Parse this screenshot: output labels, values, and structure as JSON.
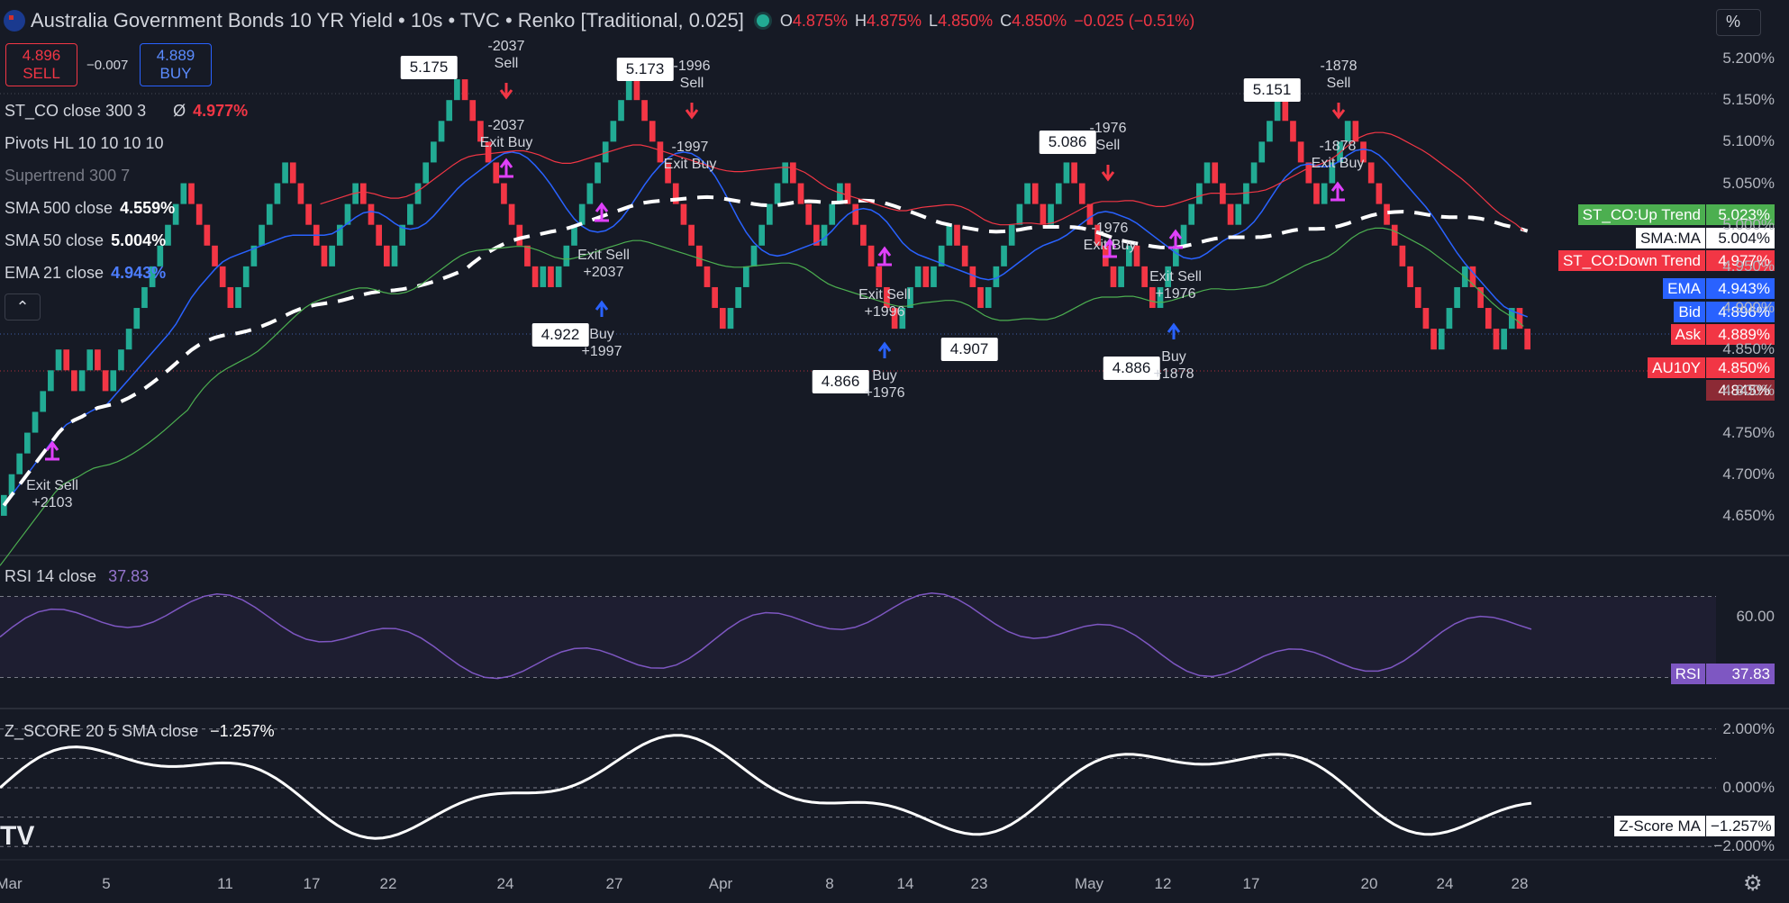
{
  "header": {
    "title": "Australia Government Bonds 10 YR Yield • 10s • TVC • Renko [Traditional, 0.025]",
    "ohlc": [
      {
        "k": "O",
        "v": "4.875%"
      },
      {
        "k": "H",
        "v": "4.875%"
      },
      {
        "k": "L",
        "v": "4.850%"
      },
      {
        "k": "C",
        "v": "4.850%"
      }
    ],
    "change": "−0.025 (−0.51%)",
    "scale_button": "%"
  },
  "trade": {
    "sell_price": "4.896",
    "sell_label": "SELL",
    "spread": "−0.007",
    "buy_price": "4.889",
    "buy_label": "BUY"
  },
  "indicators": [
    {
      "name": "ST_CO close 300 3",
      "extra": "Ø",
      "value": "4.977%",
      "color": "#f23645"
    },
    {
      "name": "Pivots HL 10 10 10 10",
      "value": "",
      "color": "#d1d4dc"
    },
    {
      "name": "Supertrend 300 7",
      "value": "",
      "color": "#787b86"
    },
    {
      "name": "SMA 500 close",
      "value": "4.559%",
      "color": "#ffffff"
    },
    {
      "name": "SMA 50 close",
      "value": "5.004%",
      "color": "#ffffff"
    },
    {
      "name": "EMA 21 close",
      "value": "4.943%",
      "color": "#4c7dff"
    }
  ],
  "price_tags": [
    {
      "label": "ST_CO:Up Trend",
      "value": "5.023%",
      "bg": "#4caf50",
      "fg": "#ffffff"
    },
    {
      "label": "SMA:MA",
      "value": "5.004%",
      "bg": "#ffffff",
      "fg": "#131722"
    },
    {
      "label": "ST_CO:Down Trend",
      "value": "4.977%",
      "bg": "#f23645",
      "fg": "#ffffff"
    },
    {
      "label": "EMA",
      "value": "4.943%",
      "bg": "#2962ff",
      "fg": "#ffffff"
    },
    {
      "label": "Bid",
      "value": "4.896%",
      "bg": "#2962ff",
      "fg": "#ffffff"
    },
    {
      "label": "Ask",
      "value": "4.889%",
      "bg": "#f23645",
      "fg": "#ffffff"
    },
    {
      "label": "AU10Y",
      "value": "4.850%",
      "bg": "#f23645",
      "fg": "#ffffff"
    },
    {
      "label": "",
      "value": "4.845%",
      "bg": "#8c2a35",
      "fg": "#ffffff"
    }
  ],
  "rsi": {
    "title": "RSI 14 close",
    "value": "37.83",
    "tag_label": "RSI",
    "tag_value": "37.83"
  },
  "zscore": {
    "title": "Z_SCORE 20 5 SMA close",
    "value": "−1.257%",
    "tag_label": "Z-Score MA",
    "tag_value": "−1.257%"
  },
  "colors": {
    "up": "#22ab94",
    "down": "#f23645",
    "ema": "#2962ff",
    "sma": "#ffffff",
    "rsi": "#7e57c2",
    "signal": "#e040fb"
  },
  "chart_data": {
    "type": "renko",
    "box_size": 0.025,
    "main_axis": {
      "ylim": [
        4.625,
        5.225
      ],
      "ticks": [
        "5.200%",
        "5.150%",
        "5.100%",
        "5.050%",
        "5.000%",
        "4.950%",
        "4.900%",
        "4.850%",
        "4.800%",
        "4.750%",
        "4.700%",
        "4.650%"
      ]
    },
    "x_labels": [
      "Mar",
      "5",
      "11",
      "17",
      "22",
      "24",
      "27",
      "Apr",
      "8",
      "14",
      "23",
      "May",
      "12",
      "17",
      "20",
      "24",
      "28"
    ],
    "pivots": [
      {
        "label": "5.175",
        "type": "high"
      },
      {
        "label": "5.173",
        "type": "high"
      },
      {
        "label": "5.086",
        "type": "high"
      },
      {
        "label": "5.151",
        "type": "high"
      },
      {
        "label": "4.922",
        "type": "low"
      },
      {
        "label": "4.866",
        "type": "low"
      },
      {
        "label": "4.907",
        "type": "low"
      },
      {
        "label": "4.886",
        "type": "low"
      }
    ],
    "signals": [
      {
        "text": "-2037\nSell",
        "dir": "down"
      },
      {
        "text": "-2037\nExit Buy",
        "dir": "none"
      },
      {
        "text": "Exit Sell\n+2037",
        "dir": "none"
      },
      {
        "text": "Buy\n+1997",
        "dir": "up"
      },
      {
        "text": "-1996\nSell",
        "dir": "down"
      },
      {
        "text": "-1997\nExit Buy",
        "dir": "none"
      },
      {
        "text": "Exit Sell\n+1996",
        "dir": "none"
      },
      {
        "text": "Buy\n+1976",
        "dir": "up"
      },
      {
        "text": "-1976\nSell",
        "dir": "down"
      },
      {
        "text": "-1976\nExit Buy",
        "dir": "none"
      },
      {
        "text": "Exit Sell\n+1976",
        "dir": "none"
      },
      {
        "text": "Buy\n+1878",
        "dir": "up"
      },
      {
        "text": "-1878\nSell",
        "dir": "down"
      },
      {
        "text": "-1878\nExit Buy",
        "dir": "none"
      },
      {
        "text": "Exit Sell\n+2103",
        "dir": "none"
      }
    ],
    "renko_path": [
      4.65,
      4.85,
      4.8,
      4.85,
      4.8,
      5.05,
      4.9,
      5.08,
      4.95,
      5.05,
      4.95,
      5.18,
      5.05,
      4.95,
      4.93,
      4.95,
      4.92,
      5.05,
      5.17,
      5.05,
      4.95,
      4.88,
      5.08,
      4.97,
      5.06,
      4.87,
      4.95,
      4.92,
      4.99,
      4.9,
      5.05,
      5.0,
      5.08,
      4.92,
      4.98,
      4.9,
      4.89,
      5.08,
      5.0,
      5.15,
      5.08,
      5.02,
      5.12,
      4.95,
      4.85,
      4.95,
      4.85,
      4.9,
      4.85
    ],
    "rsi": {
      "ylim": [
        20,
        80
      ],
      "ticks": [
        "60.00"
      ],
      "levels": [
        70,
        30
      ]
    },
    "zscore": {
      "ylim": [
        -2.3,
        2.3
      ],
      "ticks": [
        "2.000%",
        "0.000%",
        "−2.000%"
      ]
    }
  },
  "logo_text": "TV"
}
